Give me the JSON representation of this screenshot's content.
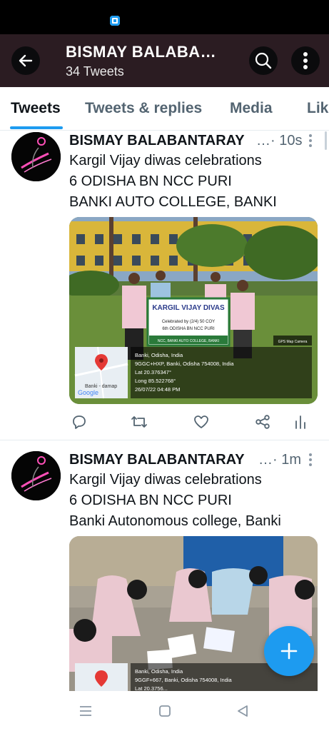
{
  "header": {
    "title": "BISMAY BALABA…",
    "subtitle": "34 Tweets"
  },
  "tabs": [
    {
      "label": "Tweets",
      "active": true
    },
    {
      "label": "Tweets & replies",
      "active": false
    },
    {
      "label": "Media",
      "active": false
    },
    {
      "label": "Lik",
      "active": false
    }
  ],
  "tweets": [
    {
      "author": "BISMAY BALABANTARAY",
      "time": "…· 10s",
      "lines": [
        "Kargil Vijay diwas celebrations",
        "6 ODISHA BN NCC PURI",
        "BANKI AUTO COLLEGE, BANKI"
      ],
      "image": {
        "banner_title": "KARGIL VIJAY DIVAS",
        "banner_line1": "Celebrated by (2/4) 50 COY",
        "banner_line2": "6th ODISHA BN NCC PURI",
        "banner_line3": "NCC, BANKI AUTO COLLEGE, BANKI",
        "gps_badge": "GPS Map Camera",
        "map_label": "Banki - damap",
        "map_brand": "Google",
        "geo": [
          "Banki, Odisha, India",
          "9GGC+HXP, Banki, Odisha 754008, India",
          "Lat 20.376347°",
          "Long 85.522768°",
          "26/07/22 04:48 PM"
        ]
      }
    },
    {
      "author": "BISMAY BALABANTARAY",
      "time": "…· 1m",
      "lines": [
        "Kargil Vijay diwas celebrations",
        "6 ODISHA BN NCC PURI",
        "Banki Autonomous college, Banki"
      ],
      "image": {
        "geo": [
          "Banki, Odisha, India",
          "9GGF+667, Banki, Odisha 754008, India",
          "Lat 20.3756..."
        ]
      }
    }
  ],
  "colors": {
    "accent": "#1d9bf0",
    "header_bg": "#2b1c22",
    "muted": "#536471"
  },
  "icons": [
    "back-arrow-icon",
    "search-icon",
    "more-vertical-icon",
    "reply-icon",
    "retweet-icon",
    "like-icon",
    "share-icon",
    "analytics-icon",
    "compose-plus-icon",
    "nav-recents-icon",
    "nav-home-icon",
    "nav-back-icon"
  ]
}
